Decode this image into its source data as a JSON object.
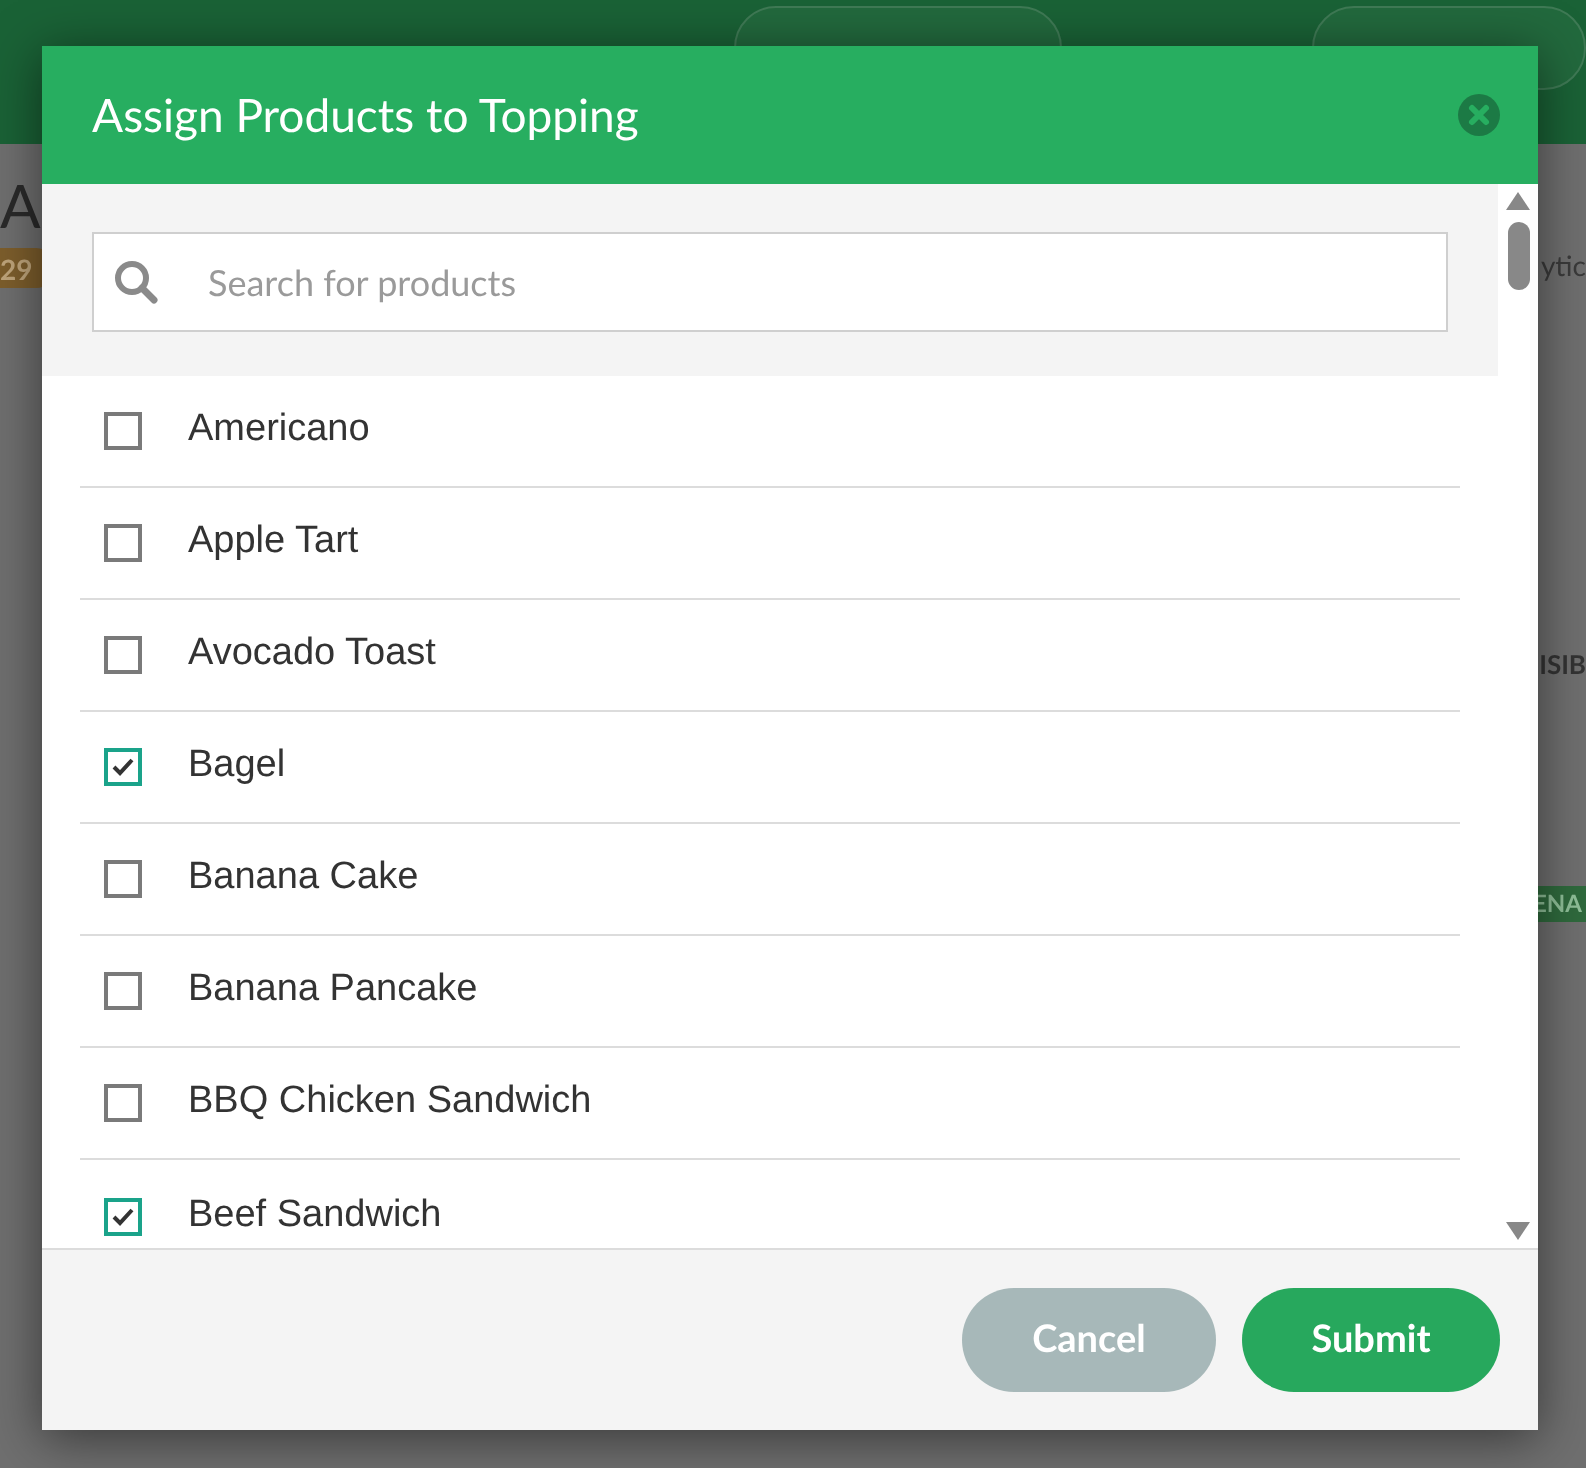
{
  "background": {
    "page_title": "A",
    "badge": "29",
    "side_link": "ytic",
    "column_heading": "ISIB",
    "status_tag": "ENA"
  },
  "dialog": {
    "title": "Assign Products to Topping",
    "search": {
      "placeholder": "Search for products"
    },
    "products": [
      {
        "name": "Americano",
        "checked": false
      },
      {
        "name": "Apple Tart",
        "checked": false
      },
      {
        "name": "Avocado Toast",
        "checked": false
      },
      {
        "name": "Bagel",
        "checked": true
      },
      {
        "name": "Banana Cake",
        "checked": false
      },
      {
        "name": "Banana Pancake",
        "checked": false
      },
      {
        "name": "BBQ Chicken Sandwich",
        "checked": false
      },
      {
        "name": "Beef Sandwich",
        "checked": true
      }
    ],
    "buttons": [
      {
        "label": "Cancel",
        "kind": "secondary"
      },
      {
        "label": "Submit",
        "kind": "primary"
      }
    ]
  }
}
